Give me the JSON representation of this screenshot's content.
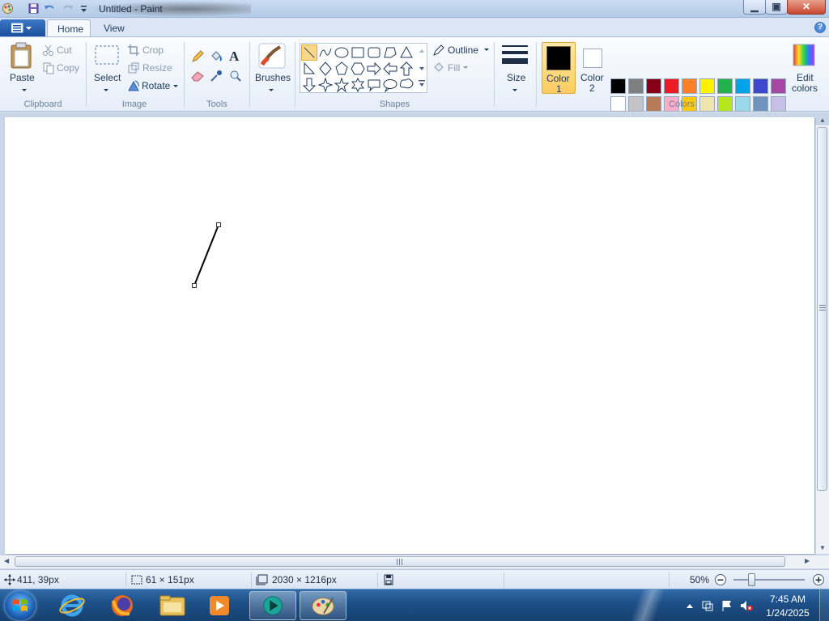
{
  "window": {
    "title": "Untitled - Paint",
    "min_glyph": "▁",
    "max_glyph": "▣",
    "close_glyph": "✕"
  },
  "tabs": [
    {
      "label": "Home"
    },
    {
      "label": "View"
    }
  ],
  "help_glyph": "?",
  "ribbon": {
    "clipboard": {
      "group": "Clipboard",
      "paste": "Paste",
      "cut": "Cut",
      "copy": "Copy"
    },
    "image": {
      "group": "Image",
      "select": "Select",
      "crop": "Crop",
      "resize": "Resize",
      "rotate": "Rotate"
    },
    "tools": {
      "group": "Tools"
    },
    "brushes": {
      "label": "Brushes"
    },
    "shapes": {
      "group": "Shapes",
      "outline": "Outline",
      "fill": "Fill"
    },
    "size": {
      "label": "Size"
    },
    "colors": {
      "group": "Colors",
      "color1_line1": "Color",
      "color1_line2": "1",
      "color2_line1": "Color",
      "color2_line2": "2",
      "edit_line1": "Edit",
      "edit_line2": "colors",
      "color1": "#000000",
      "color2": "#ffffff",
      "palette_row1": [
        "#000000",
        "#7f7f7f",
        "#880015",
        "#ed1c24",
        "#ff7f27",
        "#fff200",
        "#22b14c",
        "#00a2e8",
        "#3f48cc",
        "#a349a4"
      ],
      "palette_row2": [
        "#ffffff",
        "#c3c3c3",
        "#b97a57",
        "#ffaec9",
        "#ffc90e",
        "#efe4b0",
        "#b5e61d",
        "#99d9ea",
        "#7092be",
        "#c8bfe7"
      ]
    }
  },
  "status": {
    "cursor_pos": "411, 39px",
    "selection_size": "61 × 151px",
    "canvas_size": "2030 × 1216px",
    "zoom": "50%"
  },
  "taskbar": {
    "time": "7:45 AM",
    "date": "1/24/2025"
  }
}
